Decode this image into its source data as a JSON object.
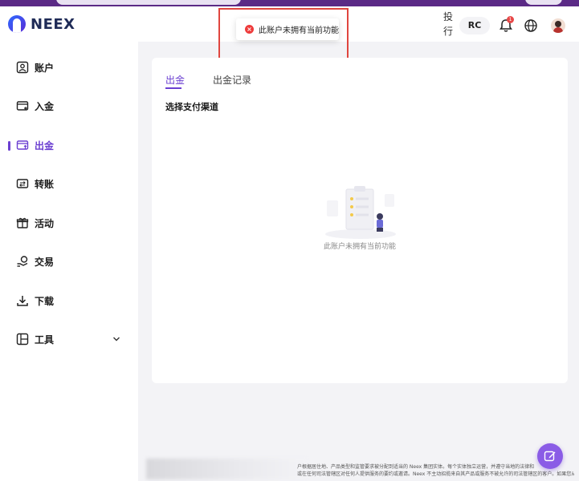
{
  "header": {
    "logo_text": "NEEX",
    "pair_line1": "投",
    "pair_line2": "行",
    "rc_label": "RC",
    "notification_count": "1"
  },
  "toast": {
    "message": "此账户未拥有当前功能",
    "icon": "error-x-icon",
    "color": "#ee3b3b"
  },
  "sidebar": {
    "items": [
      {
        "label": "账户",
        "icon": "account-icon"
      },
      {
        "label": "入金",
        "icon": "deposit-icon"
      },
      {
        "label": "出金",
        "icon": "withdraw-icon",
        "active": true
      },
      {
        "label": "转账",
        "icon": "transfer-icon"
      },
      {
        "label": "活动",
        "icon": "gift-icon"
      },
      {
        "label": "交易",
        "icon": "trade-icon"
      },
      {
        "label": "下载",
        "icon": "download-icon"
      },
      {
        "label": "工具",
        "icon": "tools-icon",
        "expandable": true
      }
    ]
  },
  "main": {
    "tabs": [
      {
        "label": "出金",
        "active": true
      },
      {
        "label": "出金记录",
        "active": false
      }
    ],
    "section_label": "选择支付渠道",
    "empty_text": "此账户未拥有当前功能"
  },
  "footer": {
    "disclaimer": "户根据居住地、产品类型和监管要求被分配到适当的 Neex 集团实体。每个实体独立运营，并遵守当地的法律和\n或在任何司法管辖区对任何人提供服务的要约或邀请。Neex 不主动招揽来自其产品或服务不被允许的司法管辖区的客户。如果您从受限国"
  },
  "colors": {
    "accent": "#6b3fd1",
    "error": "#ee3b3b",
    "badge": "#e84848"
  }
}
